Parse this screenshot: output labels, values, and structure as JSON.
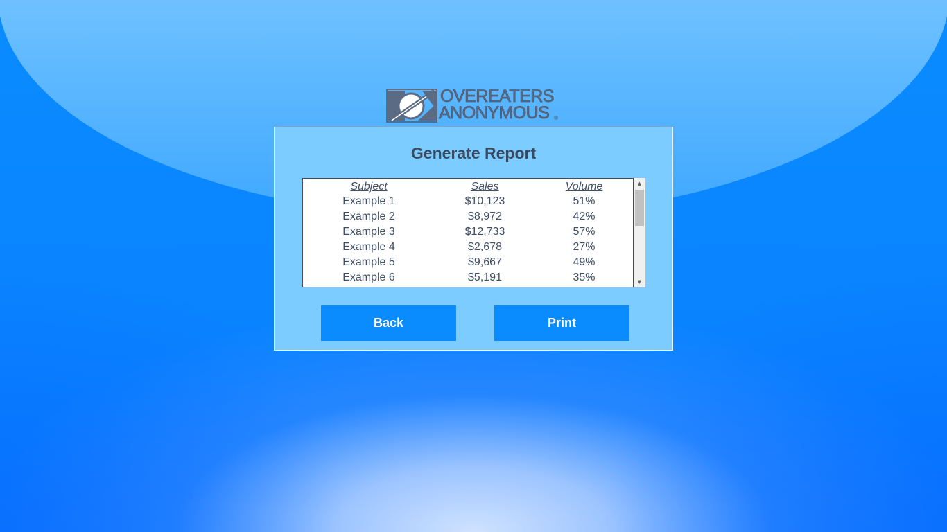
{
  "logo": {
    "line1": "OVEREATERS",
    "line2": "ANONYMOUS",
    "reg_mark": "®",
    "icon": "oa-logo-mark",
    "color": "#5b6b84"
  },
  "panel": {
    "title": "Generate Report"
  },
  "report": {
    "columns": [
      "Subject",
      "Sales",
      "Volume"
    ],
    "rows": [
      [
        "Example 1",
        "$10,123",
        "51%"
      ],
      [
        "Example 2",
        "$8,972",
        "42%"
      ],
      [
        "Example 3",
        "$12,733",
        "57%"
      ],
      [
        "Example 4",
        "$2,678",
        "27%"
      ],
      [
        "Example 5",
        "$9,667",
        "49%"
      ],
      [
        "Example 6",
        "$5,191",
        "35%"
      ]
    ],
    "scroll_up_icon": "▲",
    "scroll_down_icon": "▼"
  },
  "buttons": {
    "back_label": "Back",
    "print_label": "Print"
  },
  "colors": {
    "background": "#0a84ff",
    "panel": "#7dccff",
    "button": "#0a8cff",
    "text": "#3f4f66"
  }
}
